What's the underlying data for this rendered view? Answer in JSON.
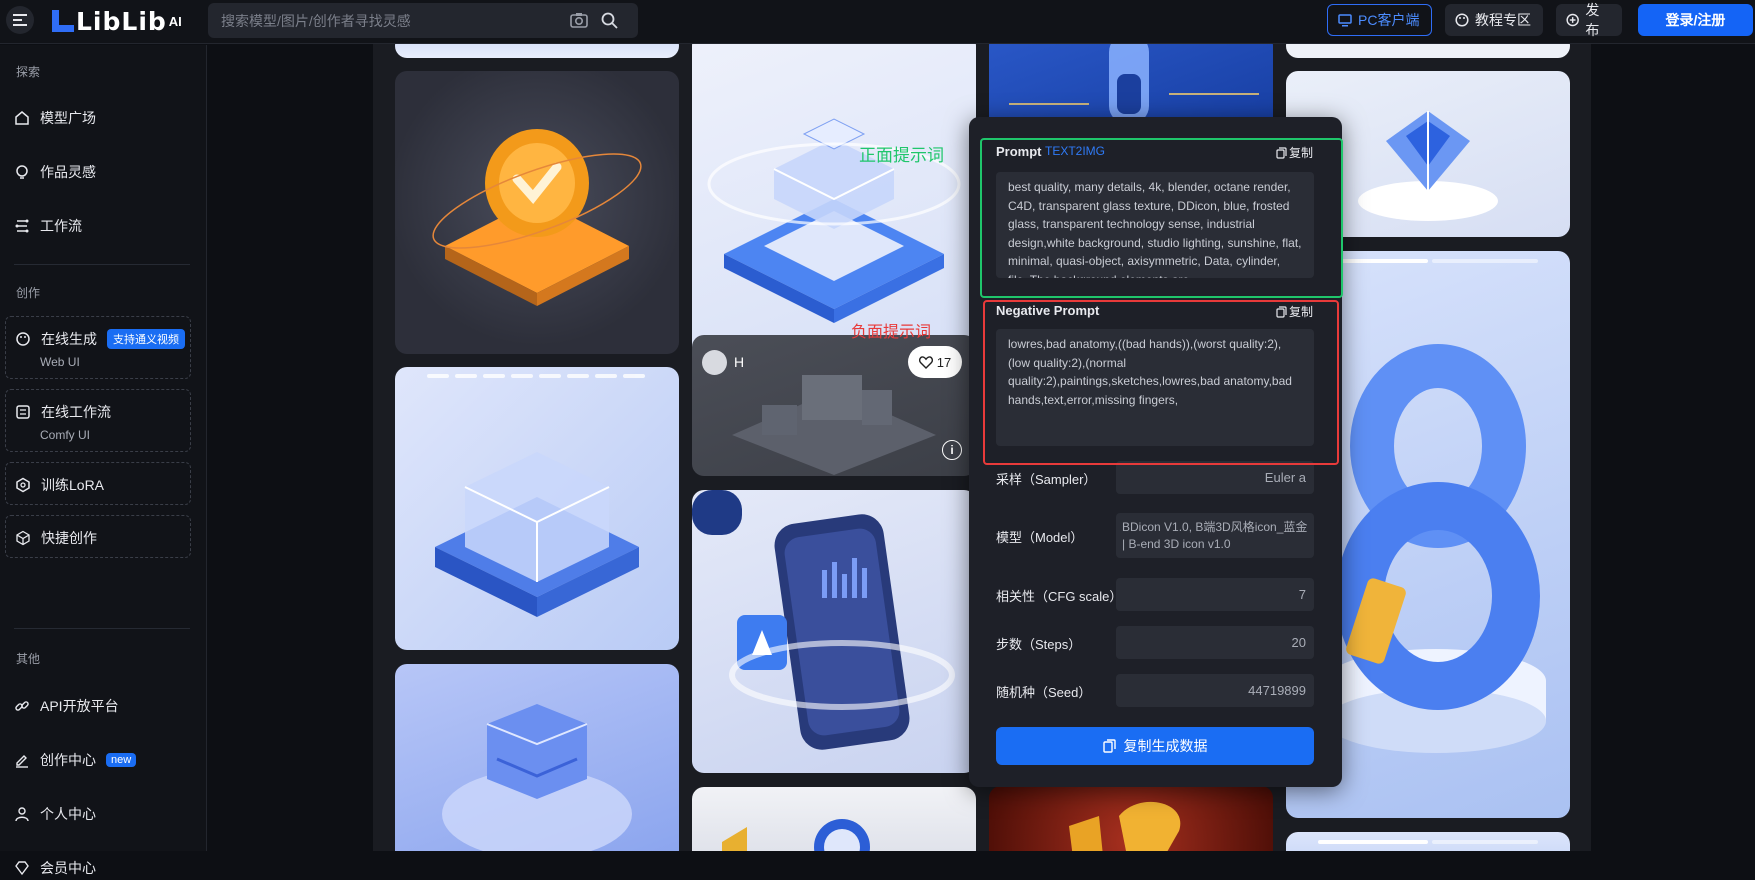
{
  "header": {
    "logo_text": "LibLib",
    "logo_suffix": "AI",
    "search_placeholder": "搜索模型/图片/创作者寻找灵感",
    "pc_client": "PC客户端",
    "tutorial": "教程专区",
    "publish": "发布",
    "login": "登录/注册"
  },
  "sidebar": {
    "explore_title": "探索",
    "explore_items": [
      "模型广场",
      "作品灵感",
      "工作流"
    ],
    "create_title": "创作",
    "online_gen": {
      "label": "在线生成",
      "badge": "支持通义视频",
      "sub": "Web UI"
    },
    "online_flow": {
      "label": "在线工作流",
      "sub": "Comfy UI"
    },
    "train_lora": "训练LoRA",
    "quick_create": "快捷创作",
    "other_title": "其他",
    "api": "API开放平台",
    "creator_center": "创作中心",
    "creator_badge": "new",
    "personal": "个人中心",
    "member": "会员中心"
  },
  "card_overlay": {
    "author_initial": "H",
    "likes": "17"
  },
  "panel": {
    "prompt_label": "Prompt",
    "prompt_tag": "TEXT2IMG",
    "copy": "复制",
    "prompt_text": "best quality, many details, 4k, blender, octane render, C4D, transparent glass texture, DDicon, blue, frosted glass, transparent technology sense, industrial design,white background, studio lighting, sunshine, flat, minimal, quasi-object, axisymmetric, Data, cylinder, file, The background elements are",
    "negative_label": "Negative Prompt",
    "negative_text": "lowres,bad anatomy,((bad hands)),(worst quality:2),(low quality:2),(normal quality:2),paintings,sketches,lowres,bad anatomy,bad hands,text,error,missing fingers,",
    "sampler_label": "采样（Sampler）",
    "sampler_value": "Euler a",
    "model_label": "模型（Model）",
    "model_value": "BDicon V1.0, B端3D风格icon_蓝金 | B-end 3D icon v1.0",
    "cfg_label": "相关性（CFG scale）",
    "cfg_value": "7",
    "steps_label": "步数（Steps）",
    "steps_value": "20",
    "seed_label": "随机种（Seed）",
    "seed_value": "44719899",
    "copy_data_button": "复制生成数据"
  },
  "annotations": {
    "positive": "正面提示词",
    "negative": "负面提示词"
  },
  "colors": {
    "accent_blue": "#1a6df3",
    "annotation_green": "#1fc66b",
    "annotation_red": "#e83a3a"
  }
}
